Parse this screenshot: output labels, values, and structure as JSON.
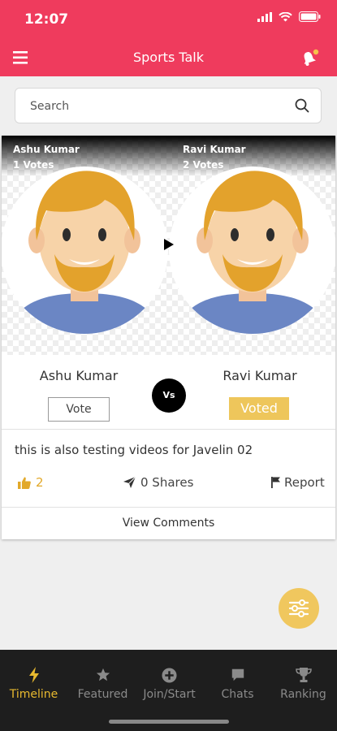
{
  "status": {
    "time": "12:07"
  },
  "header": {
    "title": "Sports Talk"
  },
  "search": {
    "placeholder": "Search"
  },
  "post": {
    "left": {
      "name_top": "Ashu Kumar",
      "votes": "1 Votes",
      "name": "Ashu Kumar",
      "button": "Vote"
    },
    "right": {
      "name_top": "Ravi Kumar",
      "votes": "2 Votes",
      "name": "Ravi Kumar",
      "button": "Voted"
    },
    "vs": "Vs",
    "text": "this is also testing  videos for Javelin 02",
    "likes": "2",
    "shares": "0 Shares",
    "report": "Report",
    "view_comments": "View Comments"
  },
  "tabs": [
    {
      "label": "Timeline",
      "icon": "bolt-icon",
      "active": true
    },
    {
      "label": "Featured",
      "icon": "star-icon"
    },
    {
      "label": "Join/Start",
      "icon": "plus-circle-icon"
    },
    {
      "label": "Chats",
      "icon": "chat-icon"
    },
    {
      "label": "Ranking",
      "icon": "trophy-icon"
    }
  ],
  "colors": {
    "brand": "#ef3b5d",
    "accent": "#e8b92f",
    "voted": "#eec65b",
    "tabbar": "#1e1e1e"
  }
}
